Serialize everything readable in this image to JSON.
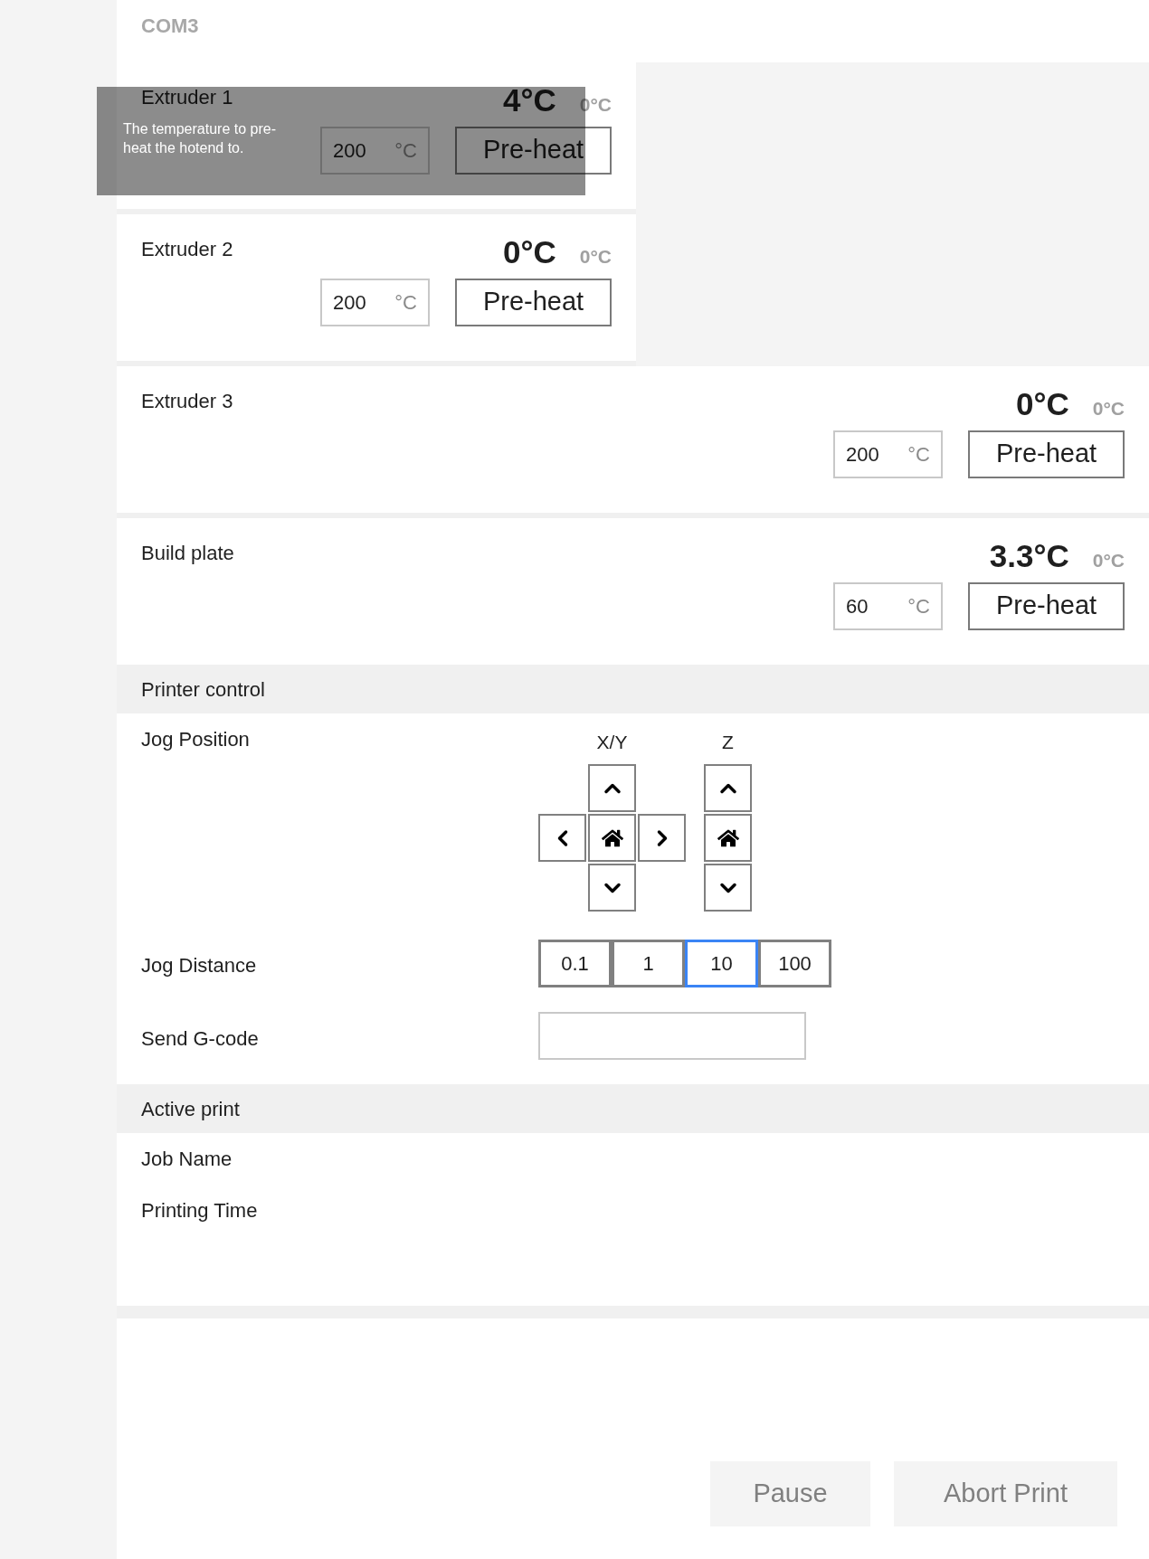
{
  "connection": {
    "port": "COM3"
  },
  "heaters": [
    {
      "kind": "half",
      "name": "Extruder 1",
      "current": "4°C",
      "target": "0°C",
      "preheat_value": "200",
      "unit": "°C",
      "button": "Pre-heat"
    },
    {
      "kind": "half",
      "name": "Extruder 2",
      "current": "0°C",
      "target": "0°C",
      "preheat_value": "200",
      "unit": "°C",
      "button": "Pre-heat"
    },
    {
      "kind": "full",
      "name": "Extruder 3",
      "current": "0°C",
      "target": "0°C",
      "preheat_value": "200",
      "unit": "°C",
      "button": "Pre-heat"
    },
    {
      "kind": "full",
      "name": "Build plate",
      "current": "3.3°C",
      "target": "0°C",
      "preheat_value": "60",
      "unit": "°C",
      "button": "Pre-heat"
    }
  ],
  "tooltip": {
    "text": "The temperature to pre-heat the hotend to."
  },
  "printer_control": {
    "title": "Printer control",
    "jog_position_label": "Jog Position",
    "xy_label": "X/Y",
    "z_label": "Z",
    "jog_distance_label": "Jog Distance",
    "distances": [
      {
        "label": "0.1",
        "selected": false
      },
      {
        "label": "1",
        "selected": false
      },
      {
        "label": "10",
        "selected": true
      },
      {
        "label": "100",
        "selected": false
      }
    ],
    "gcode_label": "Send G-code"
  },
  "active_print": {
    "title": "Active print",
    "fields": [
      {
        "label": "Job Name"
      },
      {
        "label": "Printing Time"
      }
    ]
  },
  "actions": [
    {
      "label": "Pause"
    },
    {
      "label": "Abort Print"
    }
  ]
}
